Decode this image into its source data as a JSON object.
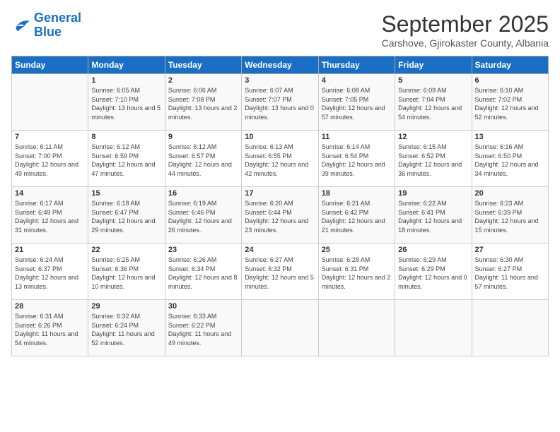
{
  "logo": {
    "line1": "General",
    "line2": "Blue"
  },
  "title": "September 2025",
  "subtitle": "Carshove, Gjirokaster County, Albania",
  "days_of_week": [
    "Sunday",
    "Monday",
    "Tuesday",
    "Wednesday",
    "Thursday",
    "Friday",
    "Saturday"
  ],
  "weeks": [
    [
      null,
      {
        "day": 1,
        "sunrise": "6:05 AM",
        "sunset": "7:10 PM",
        "daylight": "13 hours and 5 minutes."
      },
      {
        "day": 2,
        "sunrise": "6:06 AM",
        "sunset": "7:08 PM",
        "daylight": "13 hours and 2 minutes."
      },
      {
        "day": 3,
        "sunrise": "6:07 AM",
        "sunset": "7:07 PM",
        "daylight": "13 hours and 0 minutes."
      },
      {
        "day": 4,
        "sunrise": "6:08 AM",
        "sunset": "7:05 PM",
        "daylight": "12 hours and 57 minutes."
      },
      {
        "day": 5,
        "sunrise": "6:09 AM",
        "sunset": "7:04 PM",
        "daylight": "12 hours and 54 minutes."
      },
      {
        "day": 6,
        "sunrise": "6:10 AM",
        "sunset": "7:02 PM",
        "daylight": "12 hours and 52 minutes."
      }
    ],
    [
      {
        "day": 7,
        "sunrise": "6:11 AM",
        "sunset": "7:00 PM",
        "daylight": "12 hours and 49 minutes."
      },
      {
        "day": 8,
        "sunrise": "6:12 AM",
        "sunset": "6:59 PM",
        "daylight": "12 hours and 47 minutes."
      },
      {
        "day": 9,
        "sunrise": "6:12 AM",
        "sunset": "6:57 PM",
        "daylight": "12 hours and 44 minutes."
      },
      {
        "day": 10,
        "sunrise": "6:13 AM",
        "sunset": "6:55 PM",
        "daylight": "12 hours and 42 minutes."
      },
      {
        "day": 11,
        "sunrise": "6:14 AM",
        "sunset": "6:54 PM",
        "daylight": "12 hours and 39 minutes."
      },
      {
        "day": 12,
        "sunrise": "6:15 AM",
        "sunset": "6:52 PM",
        "daylight": "12 hours and 36 minutes."
      },
      {
        "day": 13,
        "sunrise": "6:16 AM",
        "sunset": "6:50 PM",
        "daylight": "12 hours and 34 minutes."
      }
    ],
    [
      {
        "day": 14,
        "sunrise": "6:17 AM",
        "sunset": "6:49 PM",
        "daylight": "12 hours and 31 minutes."
      },
      {
        "day": 15,
        "sunrise": "6:18 AM",
        "sunset": "6:47 PM",
        "daylight": "12 hours and 29 minutes."
      },
      {
        "day": 16,
        "sunrise": "6:19 AM",
        "sunset": "6:46 PM",
        "daylight": "12 hours and 26 minutes."
      },
      {
        "day": 17,
        "sunrise": "6:20 AM",
        "sunset": "6:44 PM",
        "daylight": "12 hours and 23 minutes."
      },
      {
        "day": 18,
        "sunrise": "6:21 AM",
        "sunset": "6:42 PM",
        "daylight": "12 hours and 21 minutes."
      },
      {
        "day": 19,
        "sunrise": "6:22 AM",
        "sunset": "6:41 PM",
        "daylight": "12 hours and 18 minutes."
      },
      {
        "day": 20,
        "sunrise": "6:23 AM",
        "sunset": "6:39 PM",
        "daylight": "12 hours and 15 minutes."
      }
    ],
    [
      {
        "day": 21,
        "sunrise": "6:24 AM",
        "sunset": "6:37 PM",
        "daylight": "12 hours and 13 minutes."
      },
      {
        "day": 22,
        "sunrise": "6:25 AM",
        "sunset": "6:36 PM",
        "daylight": "12 hours and 10 minutes."
      },
      {
        "day": 23,
        "sunrise": "6:26 AM",
        "sunset": "6:34 PM",
        "daylight": "12 hours and 8 minutes."
      },
      {
        "day": 24,
        "sunrise": "6:27 AM",
        "sunset": "6:32 PM",
        "daylight": "12 hours and 5 minutes."
      },
      {
        "day": 25,
        "sunrise": "6:28 AM",
        "sunset": "6:31 PM",
        "daylight": "12 hours and 2 minutes."
      },
      {
        "day": 26,
        "sunrise": "6:29 AM",
        "sunset": "6:29 PM",
        "daylight": "12 hours and 0 minutes."
      },
      {
        "day": 27,
        "sunrise": "6:30 AM",
        "sunset": "6:27 PM",
        "daylight": "11 hours and 57 minutes."
      }
    ],
    [
      {
        "day": 28,
        "sunrise": "6:31 AM",
        "sunset": "6:26 PM",
        "daylight": "11 hours and 54 minutes."
      },
      {
        "day": 29,
        "sunrise": "6:32 AM",
        "sunset": "6:24 PM",
        "daylight": "11 hours and 52 minutes."
      },
      {
        "day": 30,
        "sunrise": "6:33 AM",
        "sunset": "6:22 PM",
        "daylight": "11 hours and 49 minutes."
      },
      null,
      null,
      null,
      null
    ]
  ]
}
